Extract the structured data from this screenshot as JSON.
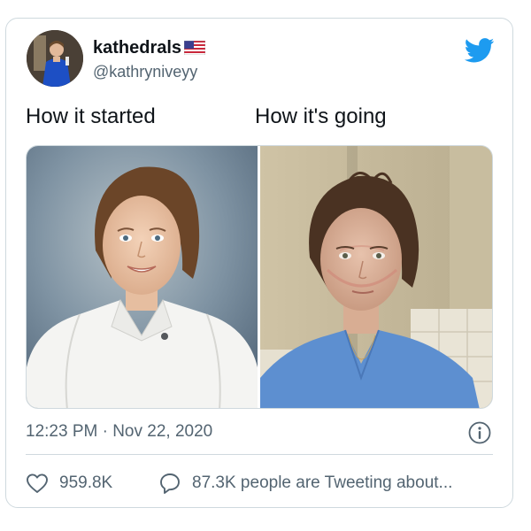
{
  "author": {
    "display_name": "kathedrals",
    "handle": "@kathryniveyy",
    "avatar_icon": "profile-photo-avatar",
    "name_emoji": "us-flag-icon"
  },
  "brand": {
    "logo_icon": "twitter-bird-icon",
    "accent_color": "#1d9bf0"
  },
  "tweet": {
    "caption_left": "How it started",
    "caption_right": "How it's going",
    "media": [
      {
        "description_icon": "portrait-photo-before"
      },
      {
        "description_icon": "portrait-photo-after"
      }
    ],
    "timestamp": "12:23 PM · Nov 22, 2020",
    "info_icon": "info-icon"
  },
  "engagement": {
    "likes_icon": "heart-icon",
    "likes_count": "959.8K",
    "replies_icon": "speech-bubble-icon",
    "tweeting_text": "87.3K people are Tweeting about..."
  }
}
